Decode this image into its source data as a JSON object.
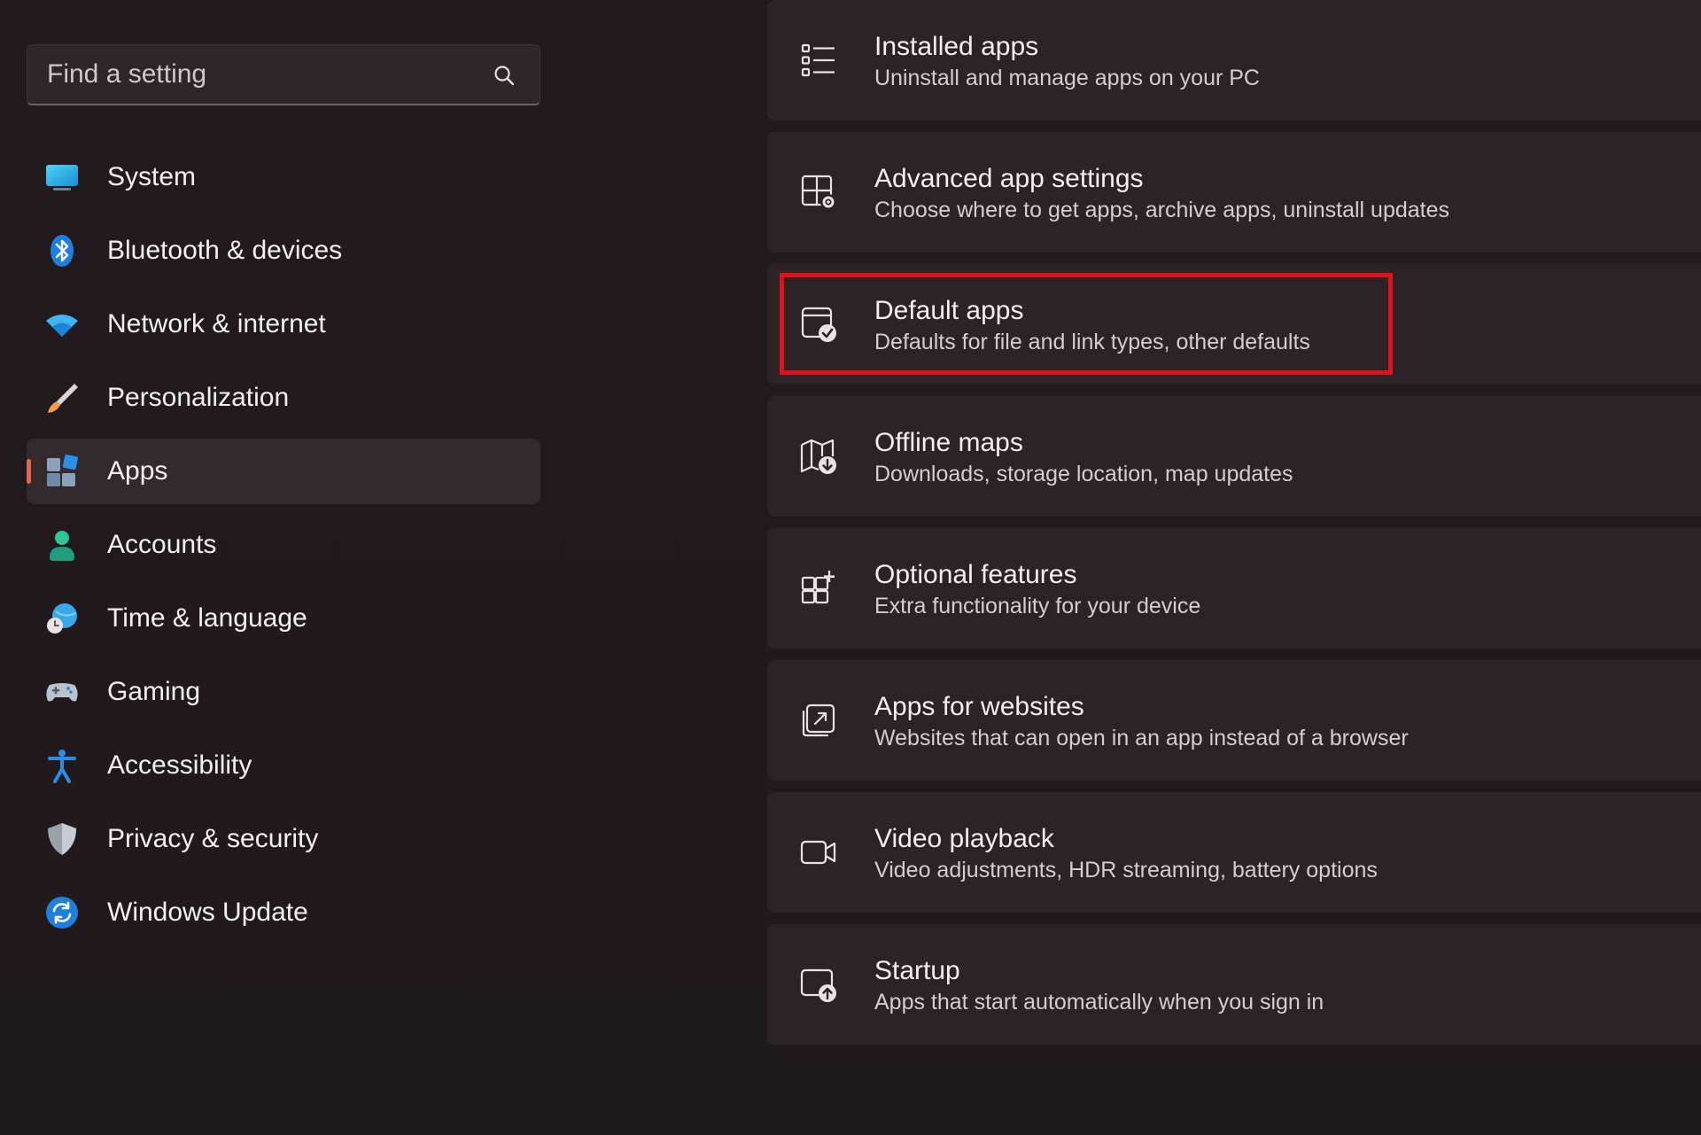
{
  "search": {
    "placeholder": "Find a setting"
  },
  "sidebar": {
    "selected_index": 4,
    "accent_color": "#e0664c",
    "items": [
      {
        "label": "System",
        "icon": "system-icon"
      },
      {
        "label": "Bluetooth & devices",
        "icon": "bluetooth-icon"
      },
      {
        "label": "Network & internet",
        "icon": "wifi-icon"
      },
      {
        "label": "Personalization",
        "icon": "brush-icon"
      },
      {
        "label": "Apps",
        "icon": "apps-icon"
      },
      {
        "label": "Accounts",
        "icon": "person-icon"
      },
      {
        "label": "Time & language",
        "icon": "globe-clock-icon"
      },
      {
        "label": "Gaming",
        "icon": "gamepad-icon"
      },
      {
        "label": "Accessibility",
        "icon": "accessibility-icon"
      },
      {
        "label": "Privacy & security",
        "icon": "shield-icon"
      },
      {
        "label": "Windows Update",
        "icon": "update-icon"
      }
    ]
  },
  "main": {
    "highlighted_index": 2,
    "highlight_color": "#e3101c",
    "items": [
      {
        "title": "Installed apps",
        "subtitle": "Uninstall and manage apps on your PC",
        "icon": "list-icon"
      },
      {
        "title": "Advanced app settings",
        "subtitle": "Choose where to get apps, archive apps, uninstall updates",
        "icon": "app-settings-icon"
      },
      {
        "title": "Default apps",
        "subtitle": "Defaults for file and link types, other defaults",
        "icon": "default-apps-icon"
      },
      {
        "title": "Offline maps",
        "subtitle": "Downloads, storage location, map updates",
        "icon": "offline-map-icon"
      },
      {
        "title": "Optional features",
        "subtitle": "Extra functionality for your device",
        "icon": "optional-features-icon"
      },
      {
        "title": "Apps for websites",
        "subtitle": "Websites that can open in an app instead of a browser",
        "icon": "open-in-app-icon"
      },
      {
        "title": "Video playback",
        "subtitle": "Video adjustments, HDR streaming, battery options",
        "icon": "video-camera-icon"
      },
      {
        "title": "Startup",
        "subtitle": "Apps that start automatically when you sign in",
        "icon": "startup-icon"
      }
    ]
  }
}
